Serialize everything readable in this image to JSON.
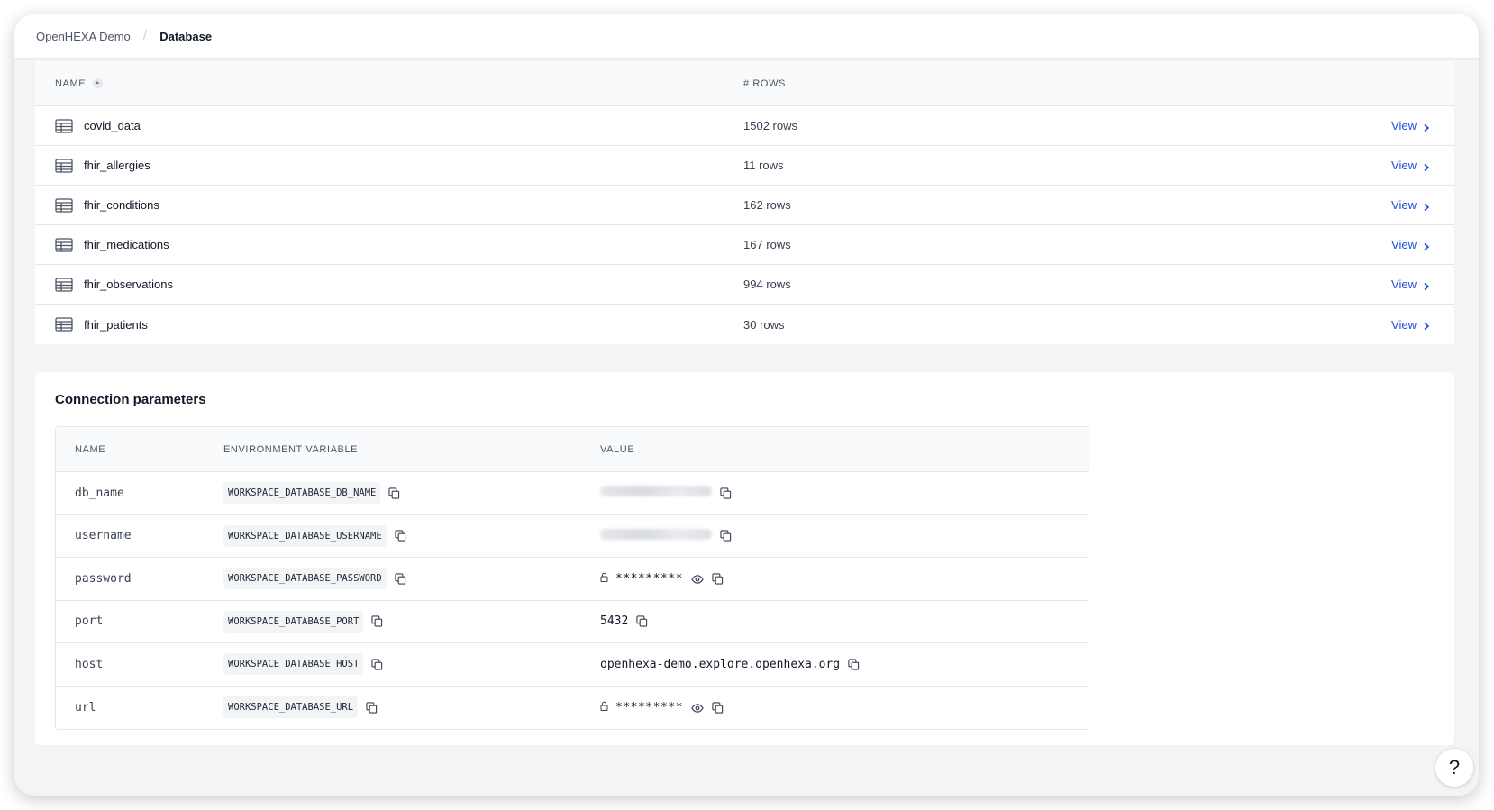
{
  "breadcrumb": {
    "workspace": "OpenHEXA Demo",
    "separator": "/",
    "current": "Database"
  },
  "tables": {
    "columns": {
      "name": "NAME",
      "rows": "# ROWS"
    },
    "view_label": "View",
    "rows": [
      {
        "name": "covid_data",
        "rows": "1502 rows"
      },
      {
        "name": "fhir_allergies",
        "rows": "11 rows"
      },
      {
        "name": "fhir_conditions",
        "rows": "162 rows"
      },
      {
        "name": "fhir_medications",
        "rows": "167 rows"
      },
      {
        "name": "fhir_observations",
        "rows": "994 rows"
      },
      {
        "name": "fhir_patients",
        "rows": "30 rows"
      }
    ]
  },
  "connection": {
    "title": "Connection parameters",
    "columns": {
      "name": "NAME",
      "env": "ENVIRONMENT VARIABLE",
      "value": "VALUE"
    },
    "rows": [
      {
        "name": "db_name",
        "env": "WORKSPACE_DATABASE_DB_NAME",
        "value_type": "blurred"
      },
      {
        "name": "username",
        "env": "WORKSPACE_DATABASE_USERNAME",
        "value_type": "blurred"
      },
      {
        "name": "password",
        "env": "WORKSPACE_DATABASE_PASSWORD",
        "value_type": "secret",
        "value": "*********"
      },
      {
        "name": "port",
        "env": "WORKSPACE_DATABASE_PORT",
        "value_type": "text",
        "value": "5432"
      },
      {
        "name": "host",
        "env": "WORKSPACE_DATABASE_HOST",
        "value_type": "text",
        "value": "openhexa-demo.explore.openhexa.org"
      },
      {
        "name": "url",
        "env": "WORKSPACE_DATABASE_URL",
        "value_type": "secret",
        "value": "*********"
      }
    ]
  },
  "help": {
    "label": "?"
  },
  "icons": {
    "table": "table-icon",
    "copy": "copy-icon",
    "lock": "lock-icon",
    "eye": "eye-icon",
    "chevron": "chevron-right-icon",
    "sort": "sort-asc-icon"
  },
  "colors": {
    "link": "#1d4ed8",
    "page_bg": "#f3f4f6",
    "header_bg": "#f9fafb"
  }
}
